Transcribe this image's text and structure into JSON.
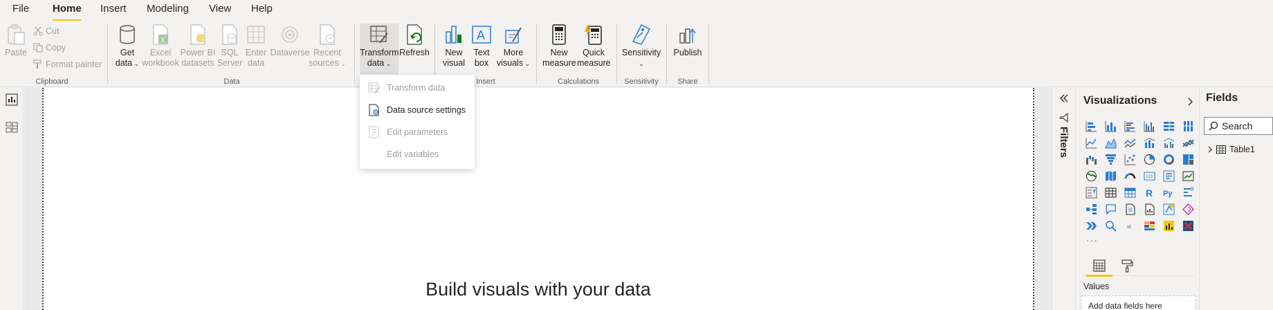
{
  "menu": {
    "items": [
      "File",
      "Home",
      "Insert",
      "Modeling",
      "View",
      "Help"
    ],
    "active": "Home"
  },
  "ribbon": {
    "clipboard": {
      "label": "Clipboard",
      "paste": "Paste",
      "cut": "Cut",
      "copy": "Copy",
      "format_painter": "Format painter"
    },
    "data": {
      "label": "Data",
      "get_data_1": "Get",
      "get_data_2": "data",
      "excel_1": "Excel",
      "excel_2": "workbook",
      "pbi_1": "Power BI",
      "pbi_2": "datasets",
      "sql_1": "SQL",
      "sql_2": "Server",
      "enter_1": "Enter",
      "enter_2": "data",
      "dataverse": "Dataverse",
      "recent_1": "Recent",
      "recent_2": "sources"
    },
    "queries": {
      "transform_1": "Transform",
      "transform_2": "data",
      "refresh": "Refresh"
    },
    "insert": {
      "label": "Insert",
      "new_visual_1": "New",
      "new_visual_2": "visual",
      "text_box_1": "Text",
      "text_box_2": "box",
      "more_visuals_1": "More",
      "more_visuals_2": "visuals"
    },
    "calculations": {
      "label": "Calculations",
      "new_measure_1": "New",
      "new_measure_2": "measure",
      "quick_measure_1": "Quick",
      "quick_measure_2": "measure"
    },
    "sensitivity": {
      "label": "Sensitivity",
      "button": "Sensitivity"
    },
    "share": {
      "label": "Share",
      "publish": "Publish"
    }
  },
  "dropdown": {
    "transform_data": "Transform data",
    "data_source_settings": "Data source settings",
    "edit_parameters": "Edit parameters",
    "edit_variables": "Edit variables"
  },
  "canvas": {
    "title": "Build visuals with your data"
  },
  "filters": {
    "label": "Filters"
  },
  "visualizations": {
    "title": "Visualizations",
    "more": "···",
    "values_label": "Values",
    "values_placeholder": "Add data fields here"
  },
  "fields": {
    "title": "Fields",
    "search_placeholder": "Search",
    "tables": [
      "Table1"
    ]
  },
  "colors": {
    "accent": "#f2c811",
    "icon_blue": "#2b7cd3",
    "disabled": "#a19f9d"
  }
}
